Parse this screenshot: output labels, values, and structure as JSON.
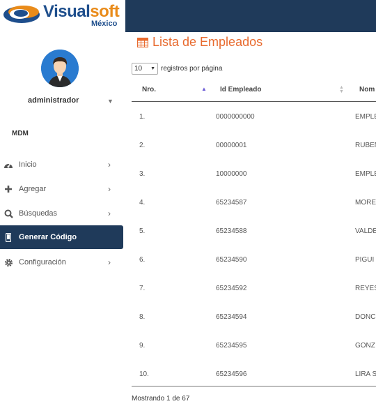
{
  "header": {
    "logo_main_1": "Visual",
    "logo_main_2": "soft",
    "logo_sub": "México"
  },
  "sidebar": {
    "username": "administrador",
    "section": "MDM",
    "items": [
      {
        "label": "Inicio",
        "icon": "dashboard-icon"
      },
      {
        "label": "Agregar",
        "icon": "plus-icon"
      },
      {
        "label": "Búsquedas",
        "icon": "search-icon"
      },
      {
        "label": "Generar Código",
        "icon": "mobile-icon",
        "active": true
      },
      {
        "label": "Configuración",
        "icon": "gear-icon"
      }
    ]
  },
  "main": {
    "title": "Lista de Empleados",
    "page_length": "10",
    "page_length_label": "registros por página",
    "columns": [
      "Nro.",
      "Id Empleado",
      "Nom"
    ],
    "rows": [
      {
        "nro": "1.",
        "id": "0000000000",
        "nombre": "EMPLE"
      },
      {
        "nro": "2.",
        "id": "00000001",
        "nombre": "RUBEN"
      },
      {
        "nro": "3.",
        "id": "10000000",
        "nombre": "EMPLE"
      },
      {
        "nro": "4.",
        "id": "65234587",
        "nombre": "MORE"
      },
      {
        "nro": "5.",
        "id": "65234588",
        "nombre": "VALDE"
      },
      {
        "nro": "6.",
        "id": "65234590",
        "nombre": "PIGUI"
      },
      {
        "nro": "7.",
        "id": "65234592",
        "nombre": "REYES"
      },
      {
        "nro": "8.",
        "id": "65234594",
        "nombre": "DONC"
      },
      {
        "nro": "9.",
        "id": "65234595",
        "nombre": "GONZ"
      },
      {
        "nro": "10.",
        "id": "65234596",
        "nombre": "LIRA S"
      }
    ],
    "info": "Mostrando 1 de 67"
  },
  "colors": {
    "header_bg": "#1f3a5a",
    "accent": "#e86a2e",
    "active_nav": "#1f3a5a"
  }
}
